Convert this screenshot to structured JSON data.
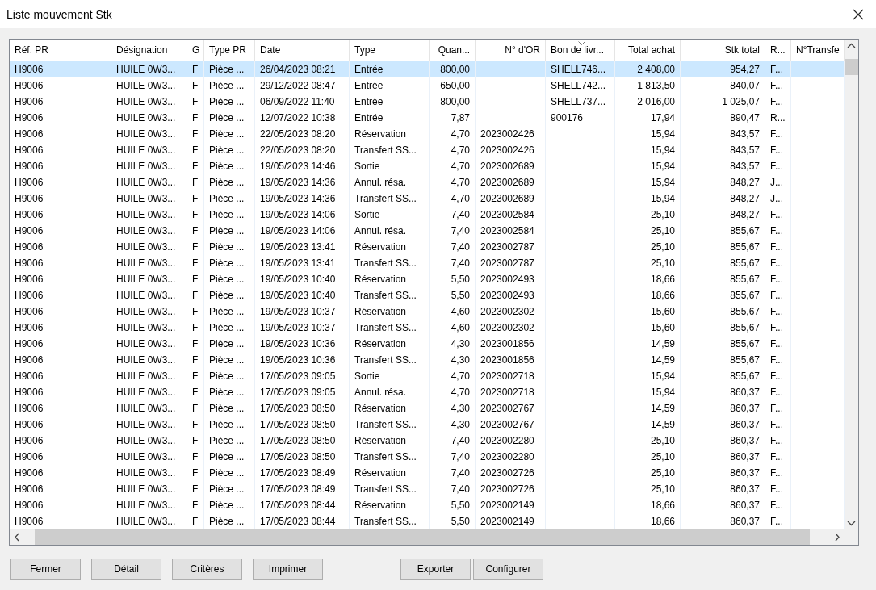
{
  "window": {
    "title": "Liste mouvement Stk"
  },
  "table": {
    "columns": [
      {
        "label": "Réf. PR",
        "sorted": false
      },
      {
        "label": "Désignation",
        "sorted": false
      },
      {
        "label": "G",
        "sorted": false
      },
      {
        "label": "Type PR",
        "sorted": false
      },
      {
        "label": "Date",
        "sorted": false
      },
      {
        "label": "Type",
        "sorted": false
      },
      {
        "label": "Quan...",
        "sorted": false
      },
      {
        "label": "N° d'OR",
        "sorted": false
      },
      {
        "label": "Bon de livr...",
        "sorted": true
      },
      {
        "label": "Total achat",
        "sorted": false
      },
      {
        "label": "Stk total",
        "sorted": false
      },
      {
        "label": "R...",
        "sorted": false
      },
      {
        "label": "N°Transfe",
        "sorted": false
      }
    ],
    "rows": [
      {
        "selected": true,
        "cells": [
          "H9006",
          "HUILE 0W3...",
          "F",
          "Pièce ...",
          "26/04/2023 08:21",
          "Entrée",
          "800,00",
          null,
          "SHELL746...",
          "2 408,00",
          "954,27",
          "F...",
          null
        ]
      },
      {
        "selected": false,
        "cells": [
          "H9006",
          "HUILE 0W3...",
          "F",
          "Pièce ...",
          "29/12/2022 08:47",
          "Entrée",
          "650,00",
          null,
          "SHELL742...",
          "1 813,50",
          "840,07",
          "F...",
          null
        ]
      },
      {
        "selected": false,
        "cells": [
          "H9006",
          "HUILE 0W3...",
          "F",
          "Pièce ...",
          "06/09/2022 11:40",
          "Entrée",
          "800,00",
          null,
          "SHELL737...",
          "2 016,00",
          "1 025,07",
          "F...",
          null
        ]
      },
      {
        "selected": false,
        "cells": [
          "H9006",
          "HUILE 0W3...",
          "F",
          "Pièce ...",
          "12/07/2022 10:38",
          "Entrée",
          "7,87",
          null,
          "900176",
          "17,94",
          "890,47",
          "R...",
          null
        ]
      },
      {
        "selected": false,
        "cells": [
          "H9006",
          "HUILE 0W3...",
          "F",
          "Pièce ...",
          "22/05/2023 08:20",
          "Réservation",
          "4,70",
          "2023002426",
          null,
          "15,94",
          "843,57",
          "F...",
          null
        ]
      },
      {
        "selected": false,
        "cells": [
          "H9006",
          "HUILE 0W3...",
          "F",
          "Pièce ...",
          "22/05/2023 08:20",
          "Transfert SS...",
          "4,70",
          "2023002426",
          null,
          "15,94",
          "843,57",
          "F...",
          null
        ]
      },
      {
        "selected": false,
        "cells": [
          "H9006",
          "HUILE 0W3...",
          "F",
          "Pièce ...",
          "19/05/2023 14:46",
          "Sortie",
          "4,70",
          "2023002689",
          null,
          "15,94",
          "843,57",
          "F...",
          null
        ]
      },
      {
        "selected": false,
        "cells": [
          "H9006",
          "HUILE 0W3...",
          "F",
          "Pièce ...",
          "19/05/2023 14:36",
          "Annul. résa.",
          "4,70",
          "2023002689",
          null,
          "15,94",
          "848,27",
          "J...",
          null
        ]
      },
      {
        "selected": false,
        "cells": [
          "H9006",
          "HUILE 0W3...",
          "F",
          "Pièce ...",
          "19/05/2023 14:36",
          "Transfert SS...",
          "4,70",
          "2023002689",
          null,
          "15,94",
          "848,27",
          "J...",
          null
        ]
      },
      {
        "selected": false,
        "cells": [
          "H9006",
          "HUILE 0W3...",
          "F",
          "Pièce ...",
          "19/05/2023 14:06",
          "Sortie",
          "7,40",
          "2023002584",
          null,
          "25,10",
          "848,27",
          "F...",
          null
        ]
      },
      {
        "selected": false,
        "cells": [
          "H9006",
          "HUILE 0W3...",
          "F",
          "Pièce ...",
          "19/05/2023 14:06",
          "Annul. résa.",
          "7,40",
          "2023002584",
          null,
          "25,10",
          "855,67",
          "F...",
          null
        ]
      },
      {
        "selected": false,
        "cells": [
          "H9006",
          "HUILE 0W3...",
          "F",
          "Pièce ...",
          "19/05/2023 13:41",
          "Réservation",
          "7,40",
          "2023002787",
          null,
          "25,10",
          "855,67",
          "F...",
          null
        ]
      },
      {
        "selected": false,
        "cells": [
          "H9006",
          "HUILE 0W3...",
          "F",
          "Pièce ...",
          "19/05/2023 13:41",
          "Transfert SS...",
          "7,40",
          "2023002787",
          null,
          "25,10",
          "855,67",
          "F...",
          null
        ]
      },
      {
        "selected": false,
        "cells": [
          "H9006",
          "HUILE 0W3...",
          "F",
          "Pièce ...",
          "19/05/2023 10:40",
          "Réservation",
          "5,50",
          "2023002493",
          null,
          "18,66",
          "855,67",
          "F...",
          null
        ]
      },
      {
        "selected": false,
        "cells": [
          "H9006",
          "HUILE 0W3...",
          "F",
          "Pièce ...",
          "19/05/2023 10:40",
          "Transfert SS...",
          "5,50",
          "2023002493",
          null,
          "18,66",
          "855,67",
          "F...",
          null
        ]
      },
      {
        "selected": false,
        "cells": [
          "H9006",
          "HUILE 0W3...",
          "F",
          "Pièce ...",
          "19/05/2023 10:37",
          "Réservation",
          "4,60",
          "2023002302",
          null,
          "15,60",
          "855,67",
          "F...",
          null
        ]
      },
      {
        "selected": false,
        "cells": [
          "H9006",
          "HUILE 0W3...",
          "F",
          "Pièce ...",
          "19/05/2023 10:37",
          "Transfert SS...",
          "4,60",
          "2023002302",
          null,
          "15,60",
          "855,67",
          "F...",
          null
        ]
      },
      {
        "selected": false,
        "cells": [
          "H9006",
          "HUILE 0W3...",
          "F",
          "Pièce ...",
          "19/05/2023 10:36",
          "Réservation",
          "4,30",
          "2023001856",
          null,
          "14,59",
          "855,67",
          "F...",
          null
        ]
      },
      {
        "selected": false,
        "cells": [
          "H9006",
          "HUILE 0W3...",
          "F",
          "Pièce ...",
          "19/05/2023 10:36",
          "Transfert SS...",
          "4,30",
          "2023001856",
          null,
          "14,59",
          "855,67",
          "F...",
          null
        ]
      },
      {
        "selected": false,
        "cells": [
          "H9006",
          "HUILE 0W3...",
          "F",
          "Pièce ...",
          "17/05/2023 09:05",
          "Sortie",
          "4,70",
          "2023002718",
          null,
          "15,94",
          "855,67",
          "F...",
          null
        ]
      },
      {
        "selected": false,
        "cells": [
          "H9006",
          "HUILE 0W3...",
          "F",
          "Pièce ...",
          "17/05/2023 09:05",
          "Annul. résa.",
          "4,70",
          "2023002718",
          null,
          "15,94",
          "860,37",
          "F...",
          null
        ]
      },
      {
        "selected": false,
        "cells": [
          "H9006",
          "HUILE 0W3...",
          "F",
          "Pièce ...",
          "17/05/2023 08:50",
          "Réservation",
          "4,30",
          "2023002767",
          null,
          "14,59",
          "860,37",
          "F...",
          null
        ]
      },
      {
        "selected": false,
        "cells": [
          "H9006",
          "HUILE 0W3...",
          "F",
          "Pièce ...",
          "17/05/2023 08:50",
          "Transfert SS...",
          "4,30",
          "2023002767",
          null,
          "14,59",
          "860,37",
          "F...",
          null
        ]
      },
      {
        "selected": false,
        "cells": [
          "H9006",
          "HUILE 0W3...",
          "F",
          "Pièce ...",
          "17/05/2023 08:50",
          "Réservation",
          "7,40",
          "2023002280",
          null,
          "25,10",
          "860,37",
          "F...",
          null
        ]
      },
      {
        "selected": false,
        "cells": [
          "H9006",
          "HUILE 0W3...",
          "F",
          "Pièce ...",
          "17/05/2023 08:50",
          "Transfert SS...",
          "7,40",
          "2023002280",
          null,
          "25,10",
          "860,37",
          "F...",
          null
        ]
      },
      {
        "selected": false,
        "cells": [
          "H9006",
          "HUILE 0W3...",
          "F",
          "Pièce ...",
          "17/05/2023 08:49",
          "Réservation",
          "7,40",
          "2023002726",
          null,
          "25,10",
          "860,37",
          "F...",
          null
        ]
      },
      {
        "selected": false,
        "cells": [
          "H9006",
          "HUILE 0W3...",
          "F",
          "Pièce ...",
          "17/05/2023 08:49",
          "Transfert SS...",
          "7,40",
          "2023002726",
          null,
          "25,10",
          "860,37",
          "F...",
          null
        ]
      },
      {
        "selected": false,
        "cells": [
          "H9006",
          "HUILE 0W3...",
          "F",
          "Pièce ...",
          "17/05/2023 08:44",
          "Réservation",
          "5,50",
          "2023002149",
          null,
          "18,66",
          "860,37",
          "F...",
          null
        ]
      },
      {
        "selected": false,
        "cells": [
          "H9006",
          "HUILE 0W3...",
          "F",
          "Pièce ...",
          "17/05/2023 08:44",
          "Transfert SS...",
          "5,50",
          "2023002149",
          null,
          "18,66",
          "860,37",
          "F...",
          null
        ]
      }
    ]
  },
  "buttons_left": [
    "Fermer",
    "Détail",
    "Critères",
    "Imprimer"
  ],
  "buttons_right": [
    "Exporter",
    "Configurer"
  ]
}
